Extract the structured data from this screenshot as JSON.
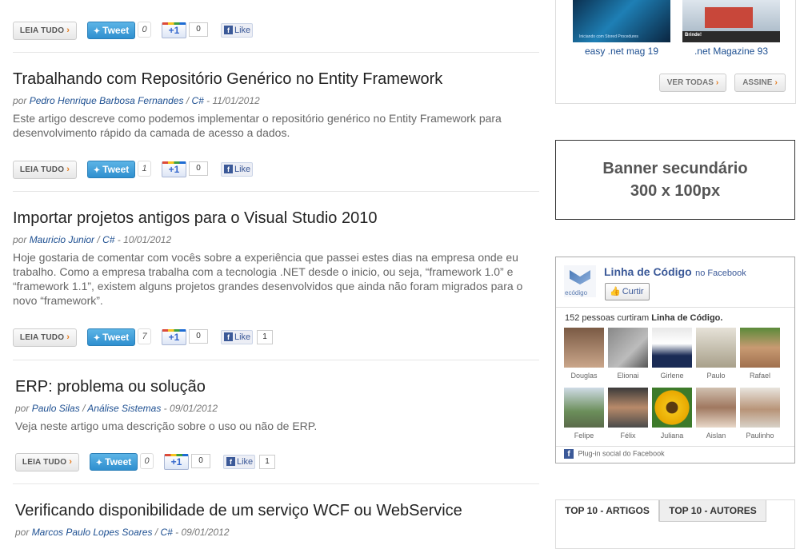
{
  "common": {
    "read_more": "LEIA TUDO",
    "tweet": "Tweet",
    "plus": "+1",
    "like": "Like"
  },
  "articles": [
    {
      "tweet_count": "0",
      "plus_count": "0"
    },
    {
      "title": "Trabalhando com Repositório Genérico no Entity Framework",
      "by": "por",
      "author": "Pedro Henrique Barbosa Fernandes",
      "category": "C#",
      "date": "11/01/2012",
      "description": "Este artigo descreve como podemos implementar o repositório genérico no Entity Framework para desenvolvimento rápido da camada de acesso a dados.",
      "tweet_count": "1",
      "plus_count": "0"
    },
    {
      "title": "Importar projetos antigos para o Visual Studio 2010",
      "by": "por",
      "author": "Mauricio Junior",
      "category": "C#",
      "date": "10/01/2012",
      "description": "Hoje gostaria de comentar com vocês sobre a experiência que passei estes dias na empresa onde eu trabalho. Como a empresa trabalha com a tecnologia .NET desde o inicio, ou seja, “framework 1.0” e “framework 1.1”, existem alguns projetos grandes desenvolvidos que ainda não foram migrados para o novo “framework”.",
      "tweet_count": "7",
      "plus_count": "0",
      "like_count": "1"
    },
    {
      "title": "ERP: problema ou solução",
      "by": "por",
      "author": "Paulo Silas",
      "category": "Análise Sistemas",
      "date": "09/01/2012",
      "description": "Veja neste artigo uma descrição sobre o uso ou não de ERP.",
      "tweet_count": "0",
      "plus_count": "0",
      "like_count": "1"
    },
    {
      "title": "Verificando disponibilidade de um serviço WCF ou WebService",
      "by": "por",
      "author": "Marcos Paulo Lopes Soares",
      "category": "C#",
      "date": "09/01/2012"
    }
  ],
  "sidebar": {
    "magazines": [
      {
        "name": "easy .net mag 19",
        "cover_text": "Iniciando com Stored Procedures"
      },
      {
        "name": ".net Magazine 93",
        "cover_text": "Brinde!"
      }
    ],
    "view_all": "VER TODAS",
    "subscribe": "ASSINE",
    "banner_line1": "Banner secundário",
    "banner_line2": "300 x 100px",
    "facebook": {
      "page_name": "Linha de Código",
      "on_facebook": "no Facebook",
      "logo_text": "ecódigo",
      "curtir": "Curtir",
      "count_text": "152 pessoas curtiram",
      "count_page": "Linha de Código.",
      "fans": [
        "Douglas",
        "Elionai",
        "Girlene",
        "Paulo",
        "Rafael",
        "Felipe",
        "Félix",
        "Juliana",
        "Aislan",
        "Paulinho"
      ],
      "plugin": "Plug-in social do Facebook",
      "colors": {
        "fb_blue": "#3b5998"
      }
    },
    "tabs": [
      "TOP 10 - ARTIGOS",
      "TOP 10 - AUTORES"
    ]
  }
}
